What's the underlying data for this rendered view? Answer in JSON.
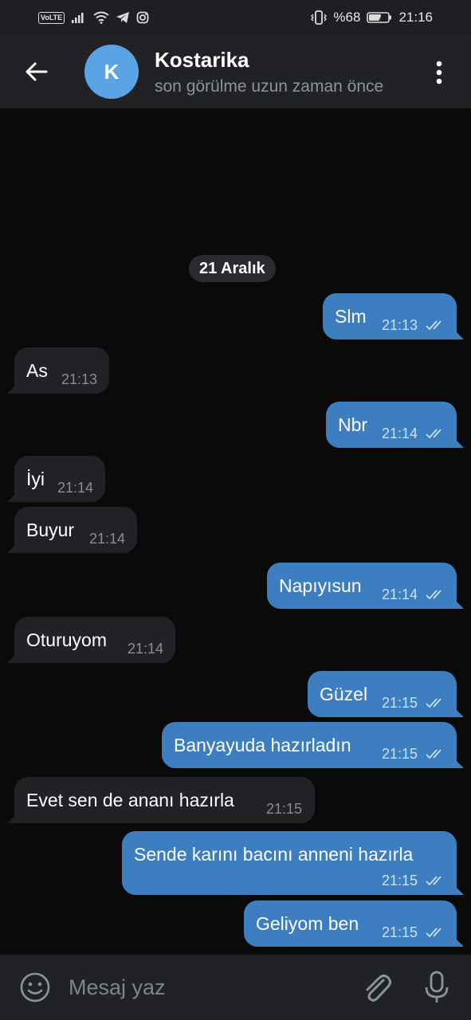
{
  "status_bar": {
    "volte": "VoLTE",
    "battery": "%68",
    "time": "21:16"
  },
  "header": {
    "avatar_letter": "K",
    "contact_name": "Kostarika",
    "last_seen": "son görülme uzun zaman önce"
  },
  "chat": {
    "date_chip": "21 Aralık",
    "messages": [
      {
        "text": "Slm",
        "time": "21:13",
        "direction": "out",
        "read": true
      },
      {
        "text": "As",
        "time": "21:13",
        "direction": "in"
      },
      {
        "text": "Nbr",
        "time": "21:14",
        "direction": "out",
        "read": true
      },
      {
        "text": "İyi",
        "time": "21:14",
        "direction": "in"
      },
      {
        "text": "Buyur",
        "time": "21:14",
        "direction": "in"
      },
      {
        "text": "Napıyısun",
        "time": "21:14",
        "direction": "out",
        "read": true
      },
      {
        "text": "Oturuyom",
        "time": "21:14",
        "direction": "in"
      },
      {
        "text": "Güzel",
        "time": "21:15",
        "direction": "out",
        "read": true
      },
      {
        "text": "Banyayuda hazırladın",
        "time": "21:15",
        "direction": "out",
        "read": true
      },
      {
        "text": "Evet sen de ananı hazırla",
        "time": "21:15",
        "direction": "in"
      },
      {
        "text": "Sende karını bacını anneni hazırla",
        "time": "21:15",
        "direction": "out",
        "read": true
      },
      {
        "text": "Geliyom ben",
        "time": "21:15",
        "direction": "out",
        "read": true
      }
    ]
  },
  "input": {
    "placeholder": "Mesaj yaz"
  },
  "colors": {
    "accent": "#5aa3e4",
    "outgoing_bubble": "#3c7ebf",
    "incoming_bubble": "#212226",
    "background": "#0a0a0b"
  },
  "icons": [
    "back-arrow-icon",
    "more-vert-icon",
    "emoji-icon",
    "attach-icon",
    "mic-icon",
    "double-check-icon"
  ]
}
